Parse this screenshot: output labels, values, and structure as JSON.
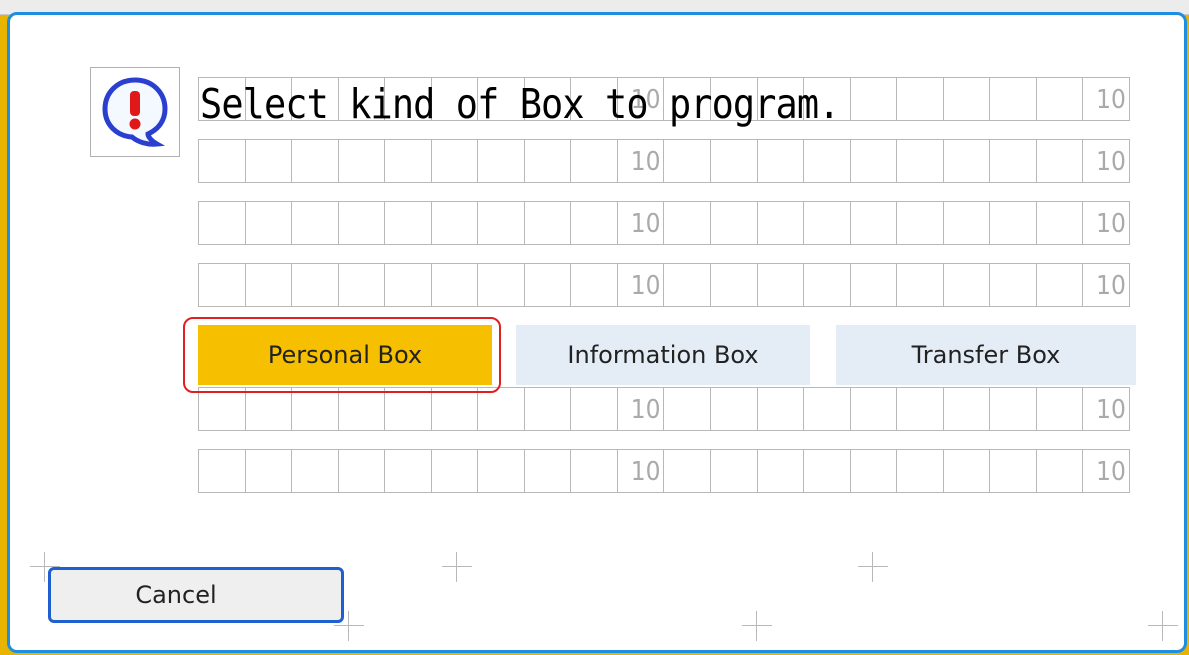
{
  "dialog": {
    "message": "Select kind of Box to program.",
    "icon": "exclamation-bubble-icon",
    "grid_marker": "10",
    "options": [
      {
        "label": "Personal Box",
        "selected": true
      },
      {
        "label": "Information Box",
        "selected": false
      },
      {
        "label": "Transfer Box",
        "selected": false
      }
    ],
    "cancel_label": "Cancel"
  },
  "colors": {
    "accent_blue": "#1e8fe0",
    "selected_option": "#f6c000",
    "unselected_option": "#e4ecf6",
    "highlight_ring": "#e02020",
    "cancel_border": "#1f5fd0"
  }
}
